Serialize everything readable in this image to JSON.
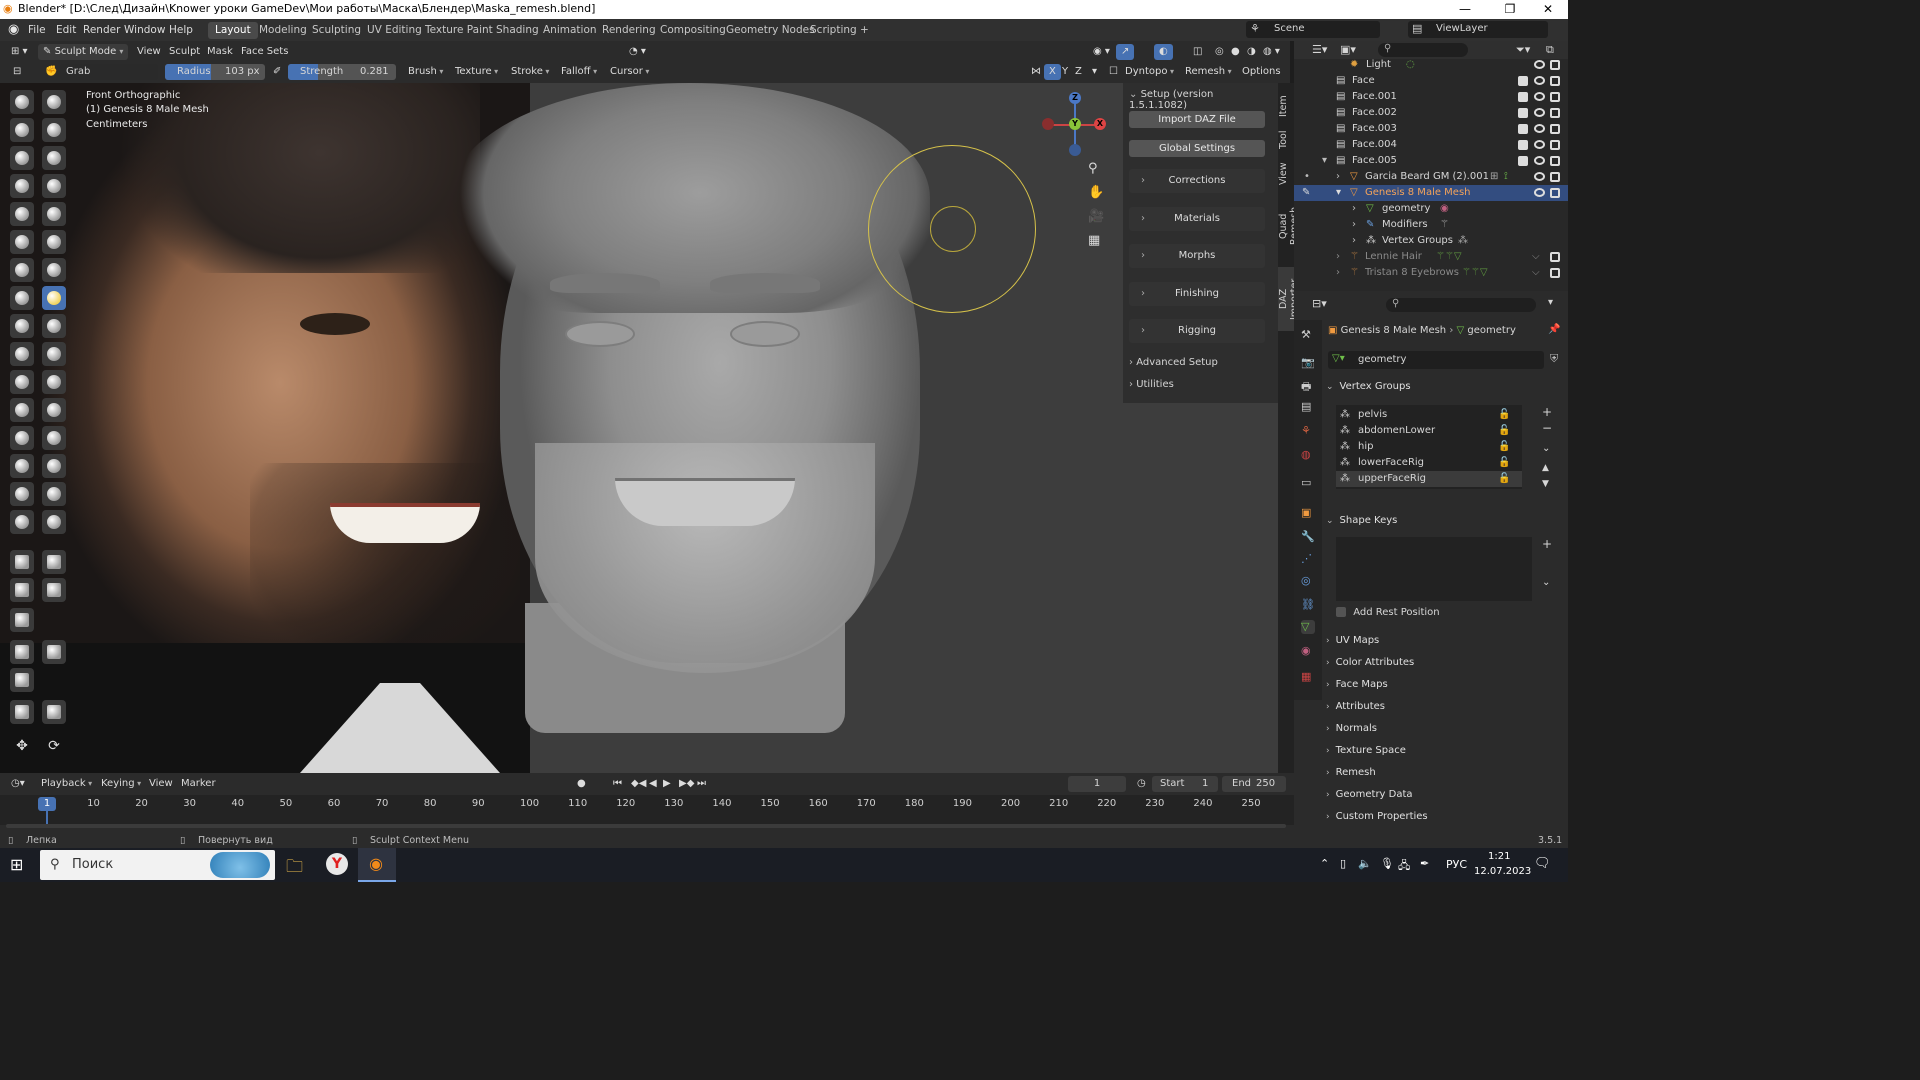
{
  "window": {
    "title": "Blender* [D:\\След\\Дизайн\\Knower уроки GameDev\\Мои работы\\Маска\\Блендер\\Maska_remesh.blend]"
  },
  "menu": [
    "File",
    "Edit",
    "Render",
    "Window",
    "Help"
  ],
  "workspaces": [
    "Layout",
    "Modeling",
    "Sculpting",
    "UV Editing",
    "Texture Paint",
    "Shading",
    "Animation",
    "Rendering",
    "Compositing",
    "Geometry Nodes",
    "Scripting"
  ],
  "active_workspace": "Layout",
  "scene": {
    "scene_name": "Scene",
    "view_layer": "ViewLayer"
  },
  "header1": {
    "mode": "Sculpt Mode",
    "menus": [
      "View",
      "Sculpt",
      "Mask",
      "Face Sets"
    ]
  },
  "header2": {
    "brush_name": "Grab",
    "radius_label": "Radius",
    "radius_value": "103 px",
    "strength_label": "Strength",
    "strength_value": "0.281",
    "menus": [
      "Brush",
      "Texture",
      "Stroke",
      "Falloff",
      "Cursor"
    ],
    "axes": [
      "X",
      "Y",
      "Z"
    ],
    "dyntopo": "Dyntopo",
    "remesh": "Remesh",
    "options": "Options"
  },
  "viewport": {
    "view_name": "Front Orthographic",
    "object": "(1) Genesis 8 Male Mesh",
    "units": "Centimeters"
  },
  "npanel": {
    "setup_title": "Setup (version 1.5.1.1082)",
    "buttons": [
      "Import DAZ File",
      "Global Settings"
    ],
    "subpanels": [
      "Corrections",
      "Materials",
      "Morphs",
      "Finishing",
      "Rigging"
    ],
    "sections": [
      "Advanced Setup",
      "Utilities"
    ],
    "tabs": [
      "Item",
      "Tool",
      "View",
      "Quad Remesh",
      "DAZ Importer"
    ]
  },
  "outliner": {
    "rows": [
      {
        "label": "Light",
        "indent": 1
      },
      {
        "label": "Face",
        "indent": 0
      },
      {
        "label": "Face.001",
        "indent": 0
      },
      {
        "label": "Face.002",
        "indent": 0
      },
      {
        "label": "Face.003",
        "indent": 0
      },
      {
        "label": "Face.004",
        "indent": 0
      },
      {
        "label": "Face.005",
        "indent": 0
      },
      {
        "label": "Garcia Beard GM (2).001",
        "indent": 1
      },
      {
        "label": "Genesis 8 Male Mesh",
        "indent": 1,
        "selected": true
      },
      {
        "label": "geometry",
        "indent": 2
      },
      {
        "label": "Modifiers",
        "indent": 2
      },
      {
        "label": "Vertex Groups",
        "indent": 2
      },
      {
        "label": "Lennie Hair",
        "indent": 1
      },
      {
        "label": "Tristan 8 Eyebrows",
        "indent": 1
      }
    ]
  },
  "properties": {
    "breadcrumb_object": "Genesis 8 Male Mesh",
    "breadcrumb_data": "geometry",
    "data_name": "geometry",
    "vertex_groups_title": "Vertex Groups",
    "vertex_groups": [
      "pelvis",
      "abdomenLower",
      "hip",
      "lowerFaceRig",
      "upperFaceRig"
    ],
    "selected_vertex_group": "upperFaceRig",
    "shape_keys_title": "Shape Keys",
    "add_rest_position": "Add Rest Position",
    "sections": [
      "UV Maps",
      "Color Attributes",
      "Face Maps",
      "Attributes",
      "Normals",
      "Texture Space",
      "Remesh",
      "Geometry Data",
      "Custom Properties"
    ]
  },
  "timeline": {
    "menus": [
      "Playback",
      "Keying",
      "View",
      "Marker"
    ],
    "current_frame": "1",
    "start_label": "Start",
    "start": "1",
    "end_label": "End",
    "end": "250",
    "ruler_current": "1",
    "ticks": [
      "10",
      "20",
      "30",
      "40",
      "50",
      "60",
      "70",
      "80",
      "90",
      "100",
      "110",
      "120",
      "130",
      "140",
      "150",
      "160",
      "170",
      "180",
      "190",
      "200",
      "210",
      "220",
      "230",
      "240",
      "250"
    ]
  },
  "statusbar": {
    "left": "Лепка",
    "middle": "Повернуть вид",
    "right": "Sculpt Context Menu",
    "version": "3.5.1"
  },
  "taskbar": {
    "search": "Поиск",
    "lang": "РУС",
    "time": "1:21",
    "date": "12.07.2023"
  },
  "colors": {
    "accent": "#4772b3",
    "selection": "#334d80",
    "brush_circle": "#d6c24a"
  }
}
